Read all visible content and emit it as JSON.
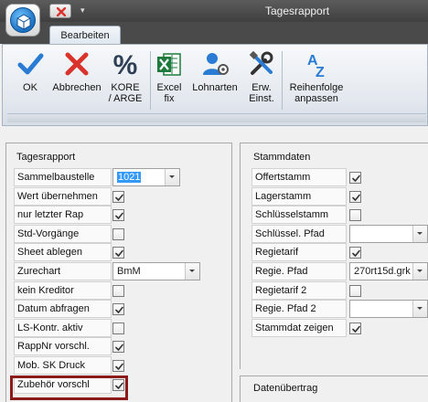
{
  "window": {
    "title": "Tagesrapport",
    "quick_access_dropdown": "▾"
  },
  "ribbon": {
    "active_tab": "Bearbeiten",
    "buttons": {
      "ok": "OK",
      "cancel": "Abbrechen",
      "kore_line1": "KORE",
      "kore_line2": "/ ARGE",
      "excel_line1": "Excel",
      "excel_line2": "fix",
      "payroll": "Lohnarten",
      "ext_line1": "Erw.",
      "ext_line2": "Einst.",
      "order_line1": "Reihenfolge",
      "order_line2": "anpassen"
    }
  },
  "left_section": {
    "title": "Tagesrapport",
    "rows": [
      {
        "label": "Sammelbaustelle",
        "type": "combo",
        "value": "1021"
      },
      {
        "label": "Wert übernehmen",
        "type": "check",
        "checked": true
      },
      {
        "label": "nur letzter Rap",
        "type": "check",
        "checked": true
      },
      {
        "label": "Std-Vorgänge",
        "type": "check",
        "checked": false
      },
      {
        "label": "Sheet ablegen",
        "type": "check",
        "checked": true
      },
      {
        "label": "Zurechart",
        "type": "combo",
        "value": "BmM"
      },
      {
        "label": "kein Kreditor",
        "type": "check",
        "checked": false
      },
      {
        "label": "Datum abfragen",
        "type": "check",
        "checked": true
      },
      {
        "label": "LS-Kontr. aktiv",
        "type": "check",
        "checked": false
      },
      {
        "label": "RappNr vorschl.",
        "type": "check",
        "checked": true
      },
      {
        "label": "Mob. SK Druck",
        "type": "check",
        "checked": true
      },
      {
        "label": "Zubehör vorschl",
        "type": "check",
        "checked": true
      }
    ]
  },
  "right_section": {
    "title": "Stammdaten",
    "rows": [
      {
        "label": "Offertstamm",
        "type": "check",
        "checked": true
      },
      {
        "label": "Lagerstamm",
        "type": "check",
        "checked": true
      },
      {
        "label": "Schlüsselstamm",
        "type": "check",
        "checked": false
      },
      {
        "label": "Schlüssel. Pfad",
        "type": "combo",
        "value": ""
      },
      {
        "label": "Regietarif",
        "type": "check",
        "checked": true
      },
      {
        "label": "Regie. Pfad",
        "type": "combo",
        "value": "270rt15d.grk"
      },
      {
        "label": "Regietarif 2",
        "type": "check",
        "checked": false
      },
      {
        "label": "Regie. Pfad 2",
        "type": "combo",
        "value": ""
      },
      {
        "label": "Stammdat zeigen",
        "type": "check",
        "checked": true
      }
    ],
    "transfer_title": "Datenübertrag"
  },
  "colors": {
    "highlight": "#8b1a1a",
    "ok_check": "#2a7bd4",
    "cancel_x": "#d9342b",
    "excel_green": "#1e7a3c"
  }
}
